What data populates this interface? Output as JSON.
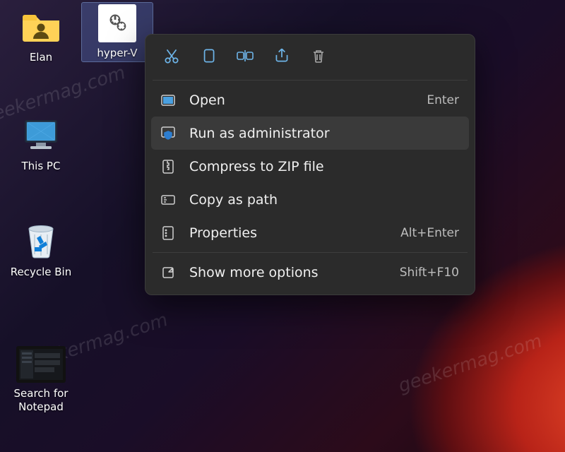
{
  "desktop_icons": {
    "elan": {
      "label": "Elan"
    },
    "hyperv": {
      "label": "hyper-V"
    },
    "this_pc": {
      "label": "This PC"
    },
    "recycle_bin": {
      "label": "Recycle Bin"
    },
    "search_np": {
      "label": "Search for\nNotepad"
    }
  },
  "context_menu": {
    "items": {
      "open": {
        "label": "Open",
        "shortcut": "Enter"
      },
      "runadmin": {
        "label": "Run as administrator",
        "shortcut": ""
      },
      "compress": {
        "label": "Compress to ZIP file",
        "shortcut": ""
      },
      "copypath": {
        "label": "Copy as path",
        "shortcut": ""
      },
      "props": {
        "label": "Properties",
        "shortcut": "Alt+Enter"
      },
      "more": {
        "label": "Show more options",
        "shortcut": "Shift+F10"
      }
    }
  },
  "watermark": "geekermag.com"
}
